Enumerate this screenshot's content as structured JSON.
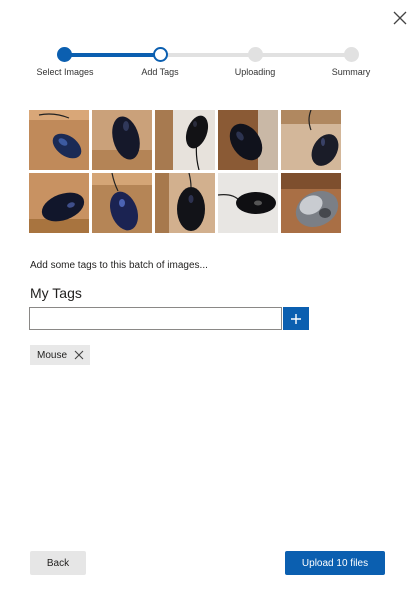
{
  "icons": {
    "close": "close-icon",
    "add": "plus-icon",
    "remove_tag": "close-icon"
  },
  "colors": {
    "accent": "#0b5fb0",
    "inactive_step": "#e1e1e1",
    "chip_bg": "#e8e8e8",
    "secondary_button": "#e6e6e6"
  },
  "stepper": {
    "steps": [
      {
        "label": "Select Images",
        "state": "complete"
      },
      {
        "label": "Add Tags",
        "state": "current"
      },
      {
        "label": "Uploading",
        "state": "pending"
      },
      {
        "label": "Summary",
        "state": "pending"
      }
    ]
  },
  "thumbnails": [
    {
      "name": "mouse-photo-1"
    },
    {
      "name": "mouse-photo-2"
    },
    {
      "name": "mouse-photo-3"
    },
    {
      "name": "mouse-photo-4"
    },
    {
      "name": "mouse-photo-5"
    },
    {
      "name": "mouse-photo-6"
    },
    {
      "name": "mouse-photo-7"
    },
    {
      "name": "mouse-photo-8"
    },
    {
      "name": "mouse-photo-9"
    },
    {
      "name": "mouse-photo-10"
    }
  ],
  "instructions": "Add some tags to this batch of images...",
  "tags_section": {
    "heading": "My Tags",
    "input_value": "",
    "input_placeholder": "",
    "tags": [
      "Mouse"
    ]
  },
  "footer": {
    "back_label": "Back",
    "upload_label": "Upload 10 files"
  }
}
